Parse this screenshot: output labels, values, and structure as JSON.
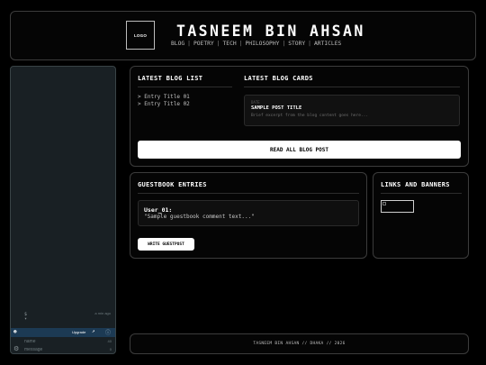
{
  "header": {
    "logo": "LOGO",
    "title": "TASNEEM BIN AHSAN",
    "nav": [
      "BLOG",
      "POETRY",
      "TECH",
      "PHILOSOPHY",
      "STORY",
      "ARTICLES"
    ],
    "nav_separator": "|"
  },
  "sidebar": {
    "timestamp": "a min ago",
    "scroll_indicator": "$",
    "scroll_arrow": "▾",
    "bar": {
      "upgrade_label": "Upgrade"
    },
    "fields": [
      {
        "label": "name",
        "meta": "40"
      },
      {
        "label": "message",
        "meta": "0"
      }
    ]
  },
  "blog": {
    "list_title": "LATEST BLOG LIST",
    "entries": [
      "> Entry Title 01",
      "> Entry Title 02"
    ],
    "cards_title": "LATEST BLOG CARDS",
    "card": {
      "date": "DATE",
      "title": "SAMPLE POST TITLE",
      "excerpt": "Brief excerpt from the blog content goes here..."
    },
    "read_all_label": "READ ALL BLOG POST"
  },
  "guestbook": {
    "title": "GUESTBOOK ENTRIES",
    "entry_user": "User_01:",
    "entry_comment": "\"Sample guestbook comment text...\"",
    "write_label": "WRITE GUESTPOST"
  },
  "links": {
    "title": "LINKS AND BANNERS"
  },
  "footer": {
    "text": "TASNEEM BIN AHSAN // DHAKA // 2026"
  },
  "colors": {
    "background": "#000000",
    "panel_border": "#3c3c3c",
    "sidebar_bg": "#192024",
    "chat_bar": "#1c3a54",
    "button_bg": "#ffffff"
  },
  "icons": {
    "user": "user-icon",
    "external": "external-link-icon",
    "info": "info-icon",
    "settings": "gear-icon"
  }
}
